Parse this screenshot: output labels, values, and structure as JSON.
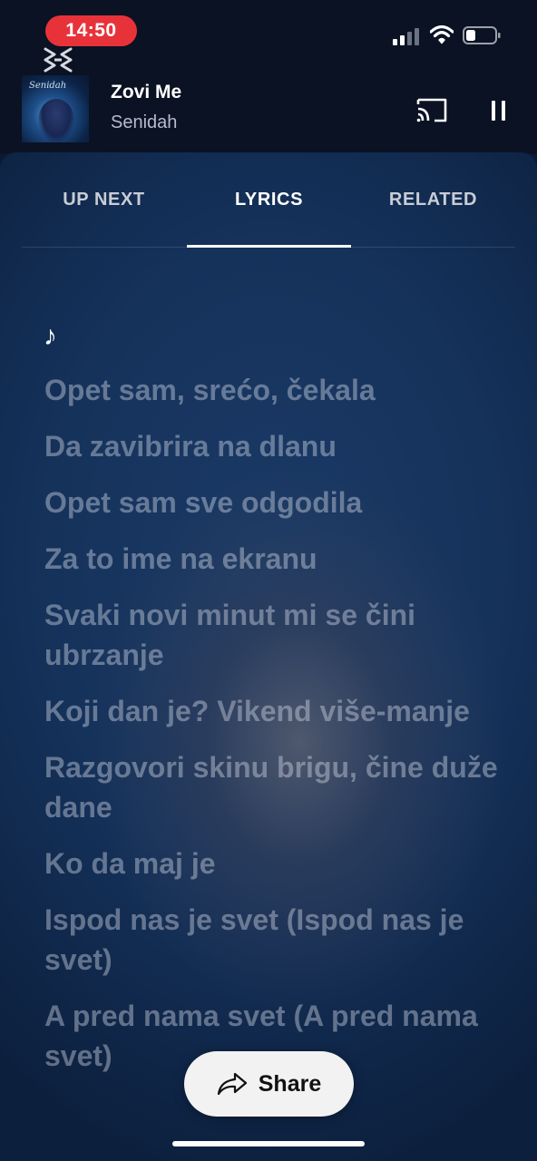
{
  "status_bar": {
    "time": "14:50",
    "icons": [
      "cellular-signal-icon",
      "wifi-icon",
      "battery-icon"
    ]
  },
  "now_playing": {
    "title": "Zovi Me",
    "artist": "Senidah",
    "album_art_text": "Senidah",
    "cast_icon": "cast-icon",
    "pause_icon": "pause-icon"
  },
  "tabs": [
    {
      "label": "UP NEXT",
      "active": false
    },
    {
      "label": "LYRICS",
      "active": true
    },
    {
      "label": "RELATED",
      "active": false
    }
  ],
  "lyrics": {
    "note_symbol": "♪",
    "lines": [
      "Opet sam, srećo, čekala",
      "Da zavibrira na dlanu",
      "Opet sam sve odgodila",
      "Za to ime na ekranu",
      "Svaki novi minut mi se čini ubrzanje",
      "Koji dan je? Vikend više-manje",
      "Razgovori skinu brigu, čine duže dane",
      "Ko da maj je",
      "Ispod nas je svet (Ispod nas je svet)",
      "A pred nama svet (A pred nama svet)"
    ]
  },
  "share": {
    "label": "Share",
    "icon": "share-arrow-icon"
  },
  "colors": {
    "time_pill": "#e8323a",
    "background": "#0b1a33",
    "lyric_text": "#d7dce6"
  }
}
